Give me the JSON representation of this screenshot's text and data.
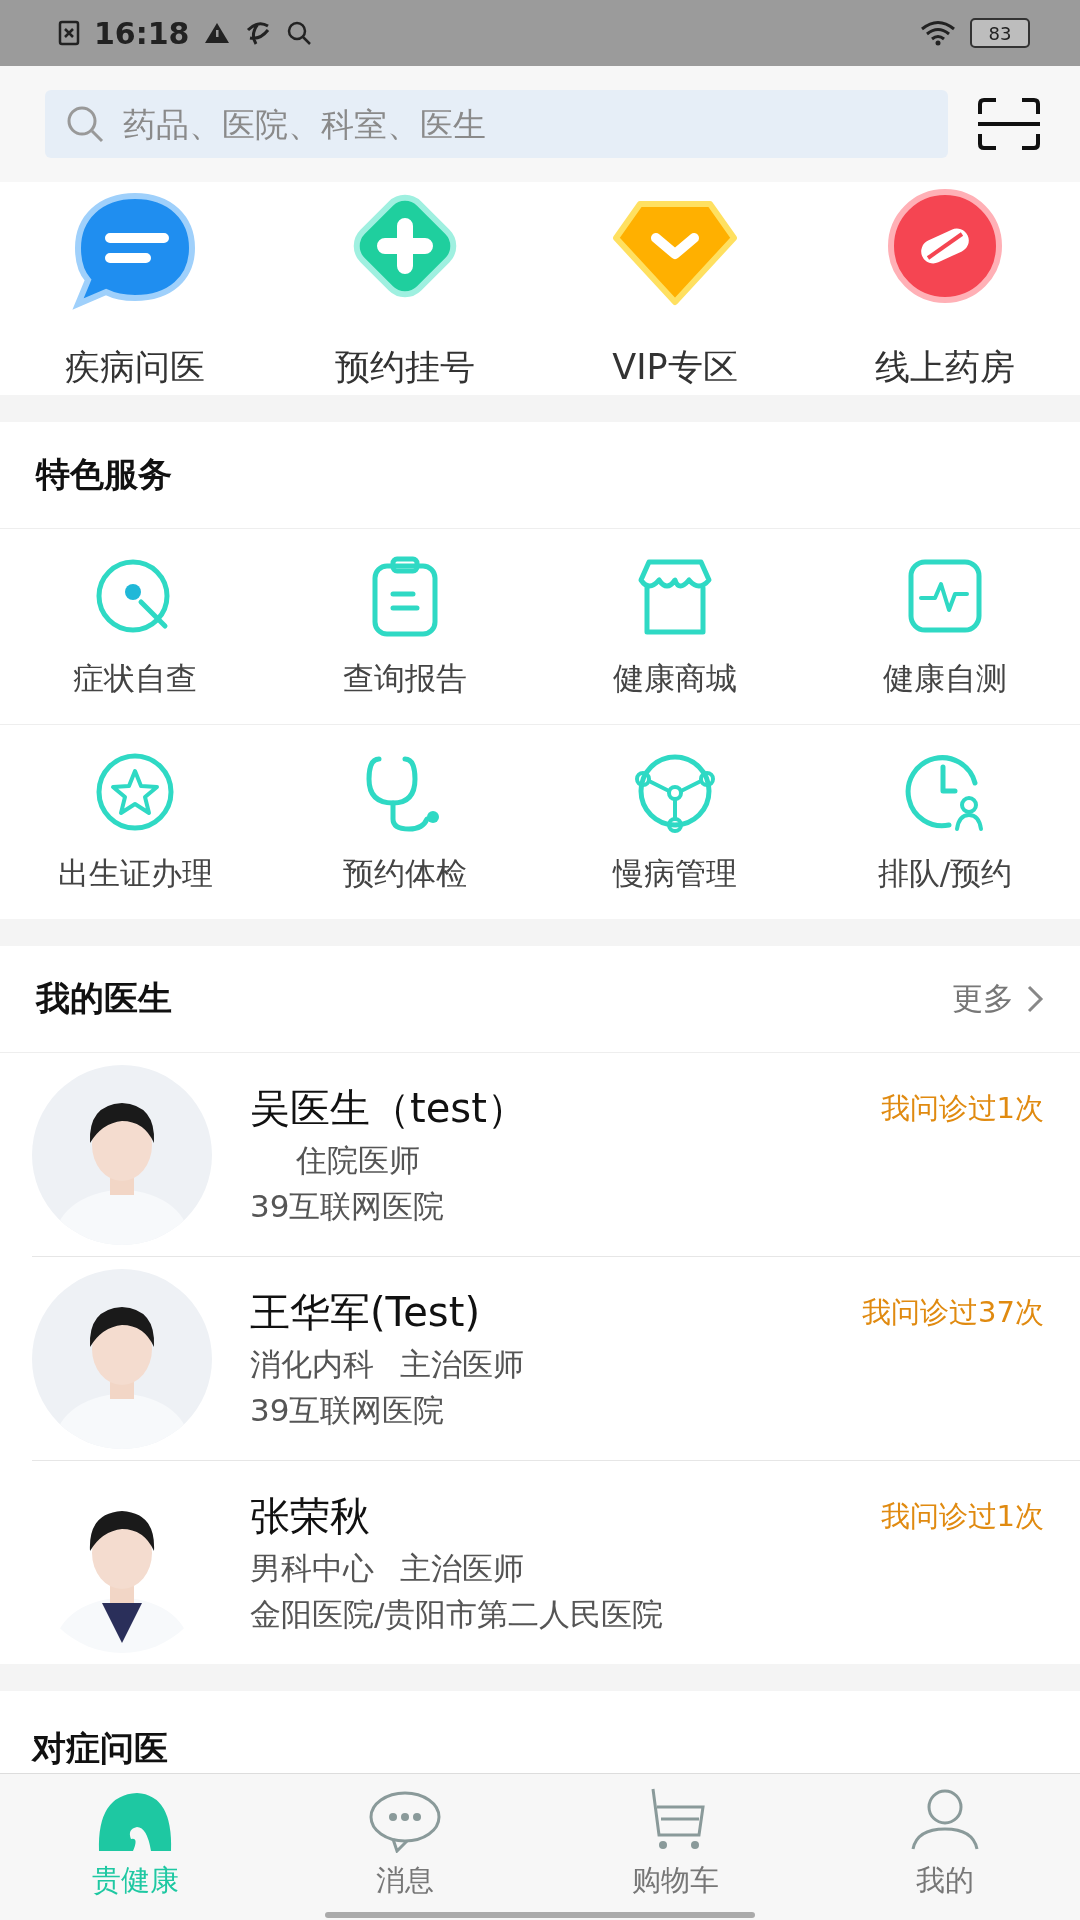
{
  "status_bar": {
    "time": "16:18",
    "battery": "83"
  },
  "search": {
    "placeholder": "药品、医院、科室、医生"
  },
  "quick_actions": [
    {
      "label": "疾病问医"
    },
    {
      "label": "预约挂号"
    },
    {
      "label": "VIP专区"
    },
    {
      "label": "线上药房"
    }
  ],
  "featured_services": {
    "title": "特色服务",
    "items": [
      {
        "label": "症状自查"
      },
      {
        "label": "查询报告"
      },
      {
        "label": "健康商城"
      },
      {
        "label": "健康自测"
      },
      {
        "label": "出生证办理"
      },
      {
        "label": "预约体检"
      },
      {
        "label": "慢病管理"
      },
      {
        "label": "排队/预约"
      }
    ]
  },
  "my_doctors": {
    "title": "我的医生",
    "more": "更多",
    "doctors": [
      {
        "name": "吴医生（test）",
        "title": "住院医师",
        "hospital": "39互联网医院",
        "visits": "我问诊过1次"
      },
      {
        "name": "王华军(Test)",
        "department": "消化内科",
        "title": "主治医师",
        "hospital": "39互联网医院",
        "visits": "我问诊过37次"
      },
      {
        "name": "张荣秋",
        "department": "男科中心",
        "title": "主治医师",
        "hospital": "金阳医院/贵阳市第二人民医院",
        "visits": "我问诊过1次"
      }
    ]
  },
  "symptom_consult": {
    "title": "对症问医"
  },
  "tab_bar": [
    {
      "label": "贵健康",
      "selected": true
    },
    {
      "label": "消息",
      "selected": false
    },
    {
      "label": "购物车",
      "selected": false
    },
    {
      "label": "我的",
      "selected": false
    }
  ]
}
